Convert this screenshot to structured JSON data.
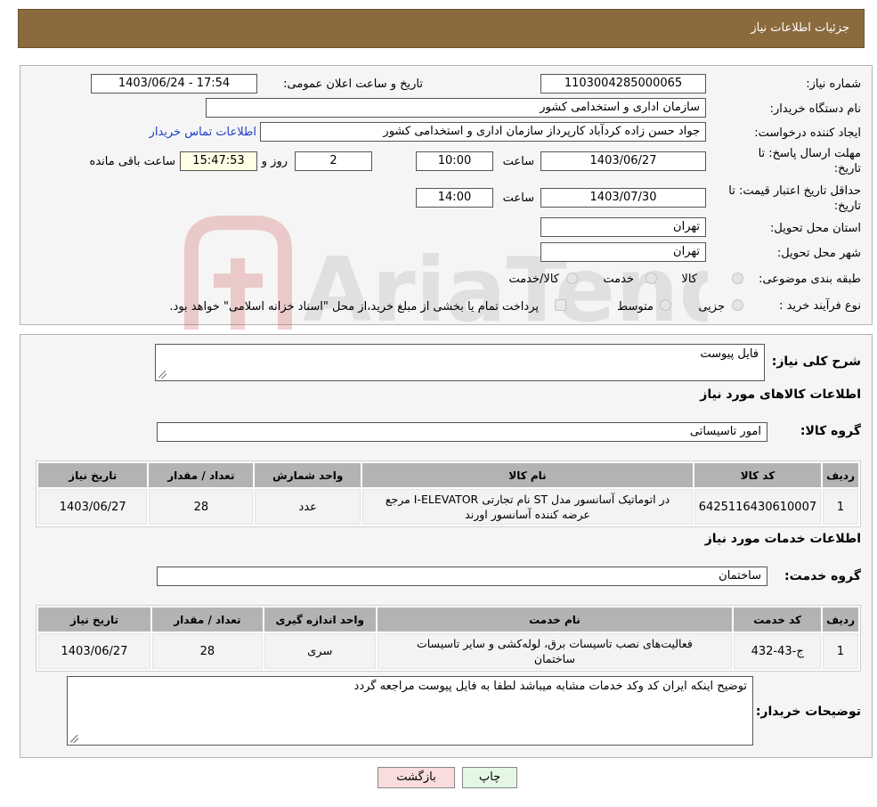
{
  "header": {
    "title": "جزئیات اطلاعات نیاز"
  },
  "form": {
    "need_number": {
      "label": "شماره نیاز:",
      "value": "1103004285000065"
    },
    "announce_datetime": {
      "label": "تاریخ و ساعت اعلان عمومی:",
      "value": "1403/06/24 - 17:54"
    },
    "buyer_org": {
      "label": "نام دستگاه خریدار:",
      "value": "سازمان اداری و استخدامی کشور"
    },
    "requester": {
      "label": "ایجاد کننده درخواست:",
      "value": "جواد حسن زاده کردآباد کارپرداز سازمان اداری و استخدامی کشور",
      "contact_link": "اطلاعات تماس خریدار"
    },
    "reply_deadline": {
      "label_line1": "مهلت ارسال پاسخ: تا",
      "label_line2": "تاریخ:",
      "date": "1403/06/27",
      "time_label": "ساعت",
      "time": "10:00",
      "days": "2",
      "days_label": "روز و",
      "remaining": "15:47:53",
      "remaining_label": "ساعت باقی مانده"
    },
    "price_validity": {
      "label_line1": "حداقل تاریخ اعتبار قیمت: تا",
      "label_line2": "تاریخ:",
      "date": "1403/07/30",
      "time_label": "ساعت",
      "time": "14:00"
    },
    "delivery_province": {
      "label": "استان محل تحویل:",
      "value": "تهران"
    },
    "delivery_city": {
      "label": "شهر محل تحویل:",
      "value": "تهران"
    },
    "category": {
      "label": "طبقه بندی موضوعی:",
      "options": [
        "کالا",
        "خدمت",
        "کالا/خدمت"
      ]
    },
    "purchase_process": {
      "label": "نوع فرآیند خرید :",
      "options": [
        "جزیی",
        "متوسط"
      ],
      "payment_note": "پرداخت تمام یا بخشی از مبلغ خرید،از محل \"اسناد خزانه اسلامی\" خواهد بود."
    }
  },
  "summary": {
    "label": "شرح کلی نیاز:",
    "value": "فایل پیوست"
  },
  "goods_section": {
    "title": "اطلاعات کالاهای مورد نیاز",
    "group_label": "گروه کالا:",
    "group_value": "امور تاسیساتی",
    "columns": [
      "ردیف",
      "کد کالا",
      "نام کالا",
      "واحد شمارش",
      "تعداد / مقدار",
      "تاریخ نیاز"
    ],
    "rows": [
      {
        "row": "1",
        "code": "6425116430610007",
        "name_line1": "در اتوماتیک آسانسور مدل ST نام تجارتی I-ELEVATOR مرجع",
        "name_line2": "عرضه کننده آسانسور اورند",
        "unit": "عدد",
        "qty": "28",
        "date": "1403/06/27"
      }
    ]
  },
  "services_section": {
    "title": "اطلاعات خدمات مورد نیاز",
    "group_label": "گروه خدمت:",
    "group_value": "ساختمان",
    "columns": [
      "ردیف",
      "کد خدمت",
      "نام خدمت",
      "واحد اندازه گیری",
      "تعداد / مقدار",
      "تاریخ نیاز"
    ],
    "rows": [
      {
        "row": "1",
        "code": "ج-43-432",
        "name_line1": "فعالیت‌های نصب تاسیسات برق، لوله‌کشی و سایر تاسیسات",
        "name_line2": "ساختمان",
        "unit": "سری",
        "qty": "28",
        "date": "1403/06/27"
      }
    ]
  },
  "buyer_notes": {
    "label": "توضیحات خریدار:",
    "value": "توضیح اینکه ایران کد وکد خدمات مشابه میباشد لطفا به فایل پیوست مراجعه گردد"
  },
  "buttons": {
    "print": "چاپ",
    "back": "بازگشت"
  },
  "watermark": {
    "text": "AriaTender.neT"
  },
  "colors": {
    "header_bg": "#8b6a3e",
    "link": "#1c3ccc",
    "back_button_bg": "#f9dcdc",
    "print_button_bg": "#e4f7e4"
  }
}
